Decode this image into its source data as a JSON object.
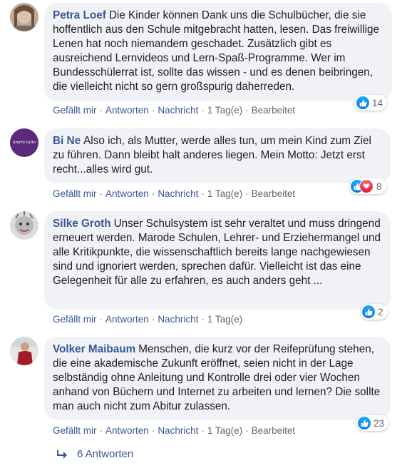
{
  "actions": {
    "like": "Gefällt mir",
    "reply": "Antworten",
    "message": "Nachricht",
    "time": "1 Tag(e)",
    "edited": "Bearbeitet",
    "sep": "·"
  },
  "comments": [
    {
      "author": "Petra Loef",
      "text": "Die Kinder können Dank uns die Schulbücher, die sie hoffentlich aus den Schule mitgebracht hatten, lesen. Das freiwillige Lenen hat noch niemandem geschadet. Zusätzlich gibt es ausreichend Lernvideos und Lern-Spaß-Programme. Wer im Bundesschülerrat ist, sollte das wissen - und es denen beibringen, die vielleicht nicht so gern großspurig daherreden.",
      "reactions_count": "14",
      "reactions": [
        "like"
      ],
      "edited": true
    },
    {
      "author": "Bi Ne",
      "avatar_text": "Andrà tutto bene",
      "text": "Also ich, als Mutter, werde alles tun, um mein Kind zum Ziel zu führen. Dann bleibt halt anderes liegen. Mein Motto: Jetzt erst recht...alles wird gut.",
      "reactions_count": "8",
      "reactions": [
        "like",
        "love"
      ],
      "edited": true
    },
    {
      "author": "Silke Groth",
      "text": "Unser Schulsystem ist sehr veraltet und muss dringend erneuert werden. Marode Schulen, Lehrer- und Erziehermangel und alle Kritikpunkte, die wissenschaftlich bereits lange nachgewiesen sind und ignoriert werden, sprechen dafür. Vielleicht ist das eine Gelegenheit für alle zu erfahren, es auch anders geht ...",
      "reactions_count": "2",
      "reactions": [
        "like"
      ],
      "edited": false
    },
    {
      "author": "Volker Maibaum",
      "text": "Menschen, die kurz vor der Reifeprüfung stehen, die eine akademische Zukunft eröffnet, seien nicht in der Lage selbständig ohne Anleitung und Kontrolle drei oder vier Wochen anhand von Büchern und Internet zu arbeiten und lernen? Die sollte man auch nicht zum Abitur zulassen.",
      "reactions_count": "23",
      "reactions": [
        "like"
      ],
      "edited": true
    }
  ],
  "replies_label": "6 Antworten",
  "colors": {
    "link": "#385898",
    "bubble": "#f0f2f5",
    "meta": "#606770",
    "like": "#0e71eb",
    "love": "#e61739"
  }
}
